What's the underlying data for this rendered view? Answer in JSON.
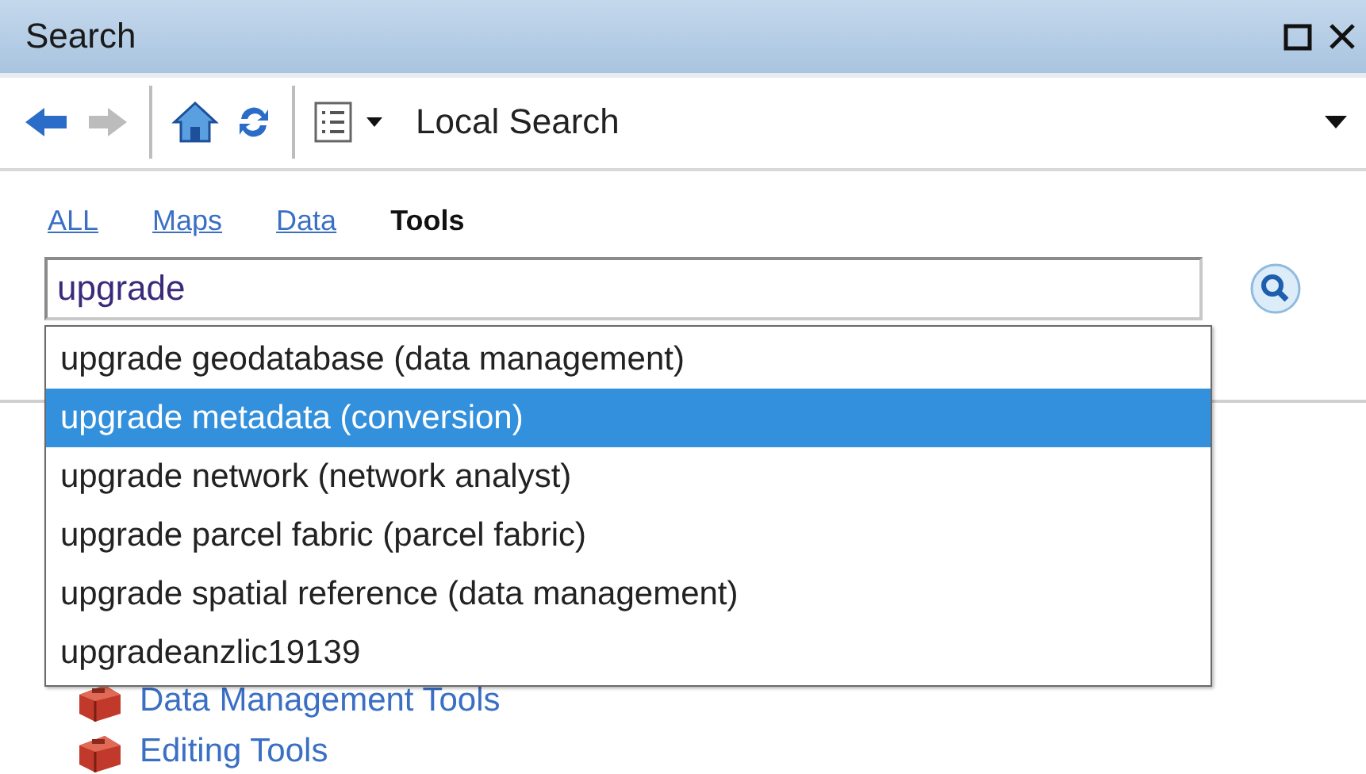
{
  "window": {
    "title": "Search"
  },
  "toolbar": {
    "location": {
      "value": "Local Search"
    }
  },
  "tabs": [
    {
      "label": "ALL",
      "selected": false
    },
    {
      "label": "Maps",
      "selected": false
    },
    {
      "label": "Data",
      "selected": false
    },
    {
      "label": "Tools",
      "selected": true
    }
  ],
  "search": {
    "value": "upgrade"
  },
  "suggestions": [
    {
      "label": "upgrade geodatabase (data management)",
      "selected": false
    },
    {
      "label": "upgrade metadata (conversion)",
      "selected": true
    },
    {
      "label": "upgrade network (network analyst)",
      "selected": false
    },
    {
      "label": "upgrade parcel fabric (parcel fabric)",
      "selected": false
    },
    {
      "label": "upgrade spatial reference (data management)",
      "selected": false
    },
    {
      "label": "upgradeanzlic19139",
      "selected": false
    }
  ],
  "results": [
    {
      "label": "Data Management Tools"
    },
    {
      "label": "Editing Tools"
    }
  ]
}
